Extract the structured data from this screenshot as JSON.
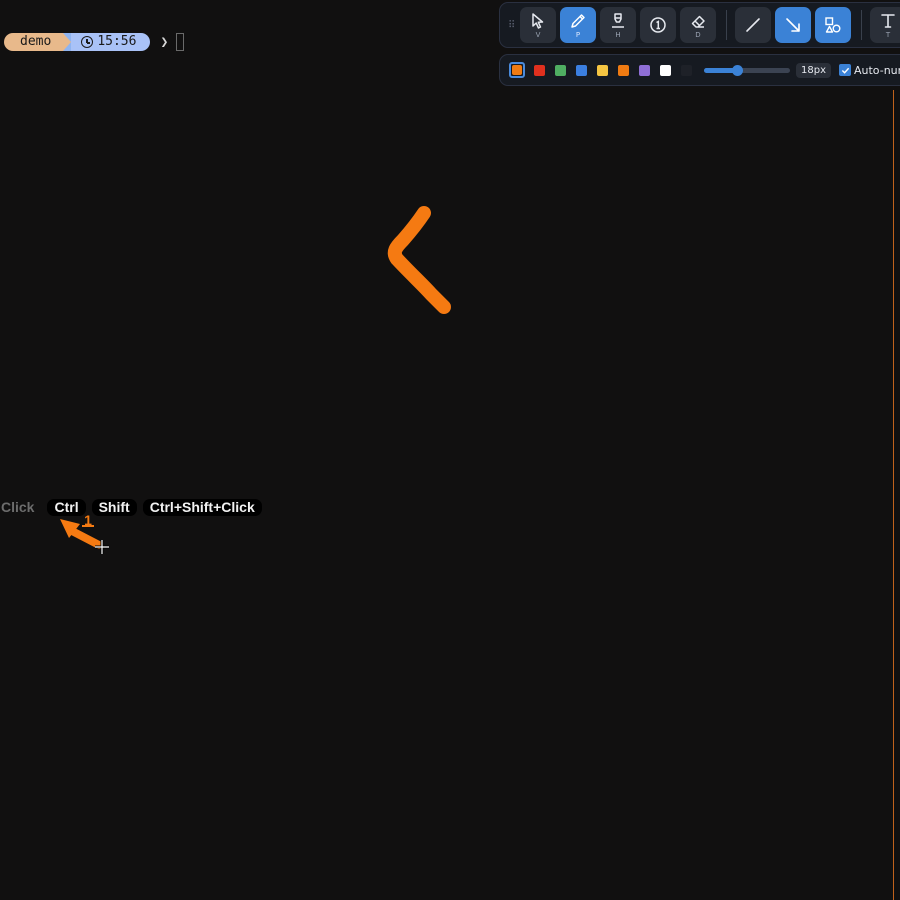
{
  "prompt": {
    "session": "demo",
    "time": "15:56",
    "chevron": "❯"
  },
  "toolbar": {
    "grip_icon": "drag-grip-icon",
    "tools": [
      {
        "name": "select",
        "icon": "cursor-arrow-icon",
        "key": "V",
        "active": false
      },
      {
        "name": "pen",
        "icon": "pen-icon",
        "key": "P",
        "active": true
      },
      {
        "name": "highlighter",
        "icon": "highlighter-icon",
        "key": "H",
        "active": false
      },
      {
        "name": "number",
        "icon": "number-badge-icon",
        "key": "",
        "active": false
      },
      {
        "name": "eraser",
        "icon": "eraser-icon",
        "key": "D",
        "active": false
      },
      {
        "name": "line",
        "icon": "line-icon",
        "key": "",
        "active": false
      },
      {
        "name": "arrow",
        "icon": "arrow-icon",
        "key": "",
        "active": true
      },
      {
        "name": "shapes",
        "icon": "shapes-icon",
        "key": "",
        "active": true
      },
      {
        "name": "text",
        "icon": "text-icon",
        "key": "T",
        "active": false
      }
    ]
  },
  "stylebar": {
    "selected_color": "#f07b12",
    "palette": [
      "#e0301e",
      "#4fae62",
      "#3b7fe0",
      "#f5c542",
      "#f07b12",
      "#8f6fd6",
      "#ffffff",
      "#1e2128"
    ],
    "stroke_fraction": 0.38,
    "stroke_size": "18px",
    "auto_number_checked": true,
    "auto_number_label": "Auto-numb"
  },
  "annotations": {
    "stroke_color": "#f57a12",
    "badge_number": "1"
  },
  "click_badges": [
    {
      "label": "Click",
      "active": false
    },
    {
      "label": "Ctrl",
      "active": true
    },
    {
      "label": "Shift",
      "active": true
    },
    {
      "label": "Ctrl+Shift+Click",
      "active": true
    }
  ]
}
